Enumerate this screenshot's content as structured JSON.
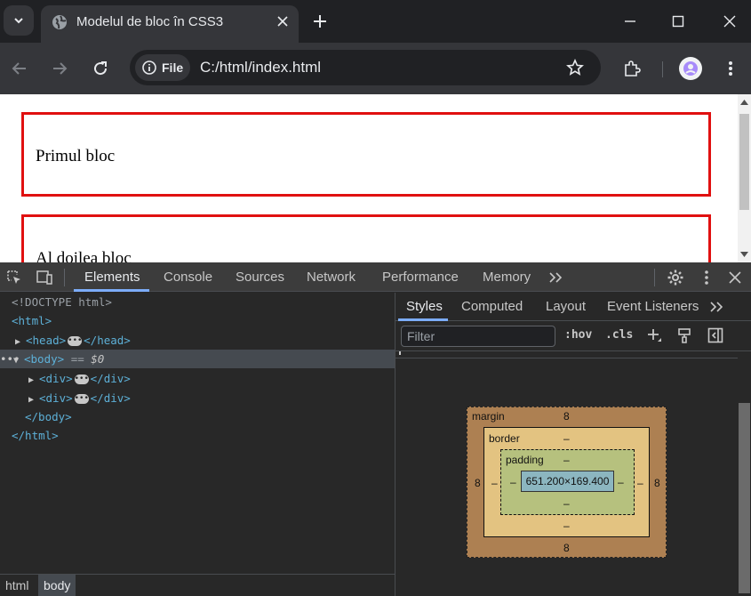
{
  "browser": {
    "tab": {
      "title": "Modelul de bloc în CSS3",
      "favicon": "globe-icon"
    },
    "chip_label": "File",
    "url": "C:/html/index.html"
  },
  "page": {
    "blocks": [
      {
        "text": "Primul bloc"
      },
      {
        "text": "Al doilea bloc"
      }
    ],
    "border_color": "#e01010"
  },
  "devtools": {
    "tabs": [
      "Elements",
      "Console",
      "Sources",
      "Network",
      "Performance",
      "Memory"
    ],
    "active_tab": "Elements",
    "dom": {
      "doctype": "<!DOCTYPE html>",
      "html_open": "<html>",
      "head_open": "<head>",
      "head_close": "</head>",
      "body_open": "<body>",
      "body_eq": "==",
      "body_ref": "$0",
      "div_open": "<div>",
      "div_close": "</div>",
      "body_close": "</body>",
      "html_close": "</html>"
    },
    "breadcrumbs": [
      "html",
      "body"
    ],
    "styles_tabs": [
      "Styles",
      "Computed",
      "Layout",
      "Event Listeners"
    ],
    "filter_placeholder": "Filter",
    "hov_label": ":hov",
    "cls_label": ".cls",
    "box_model": {
      "margin_label": "margin",
      "border_label": "border",
      "padding_label": "padding",
      "margin_top": "8",
      "margin_bottom": "8",
      "margin_left": "8",
      "margin_right": "8",
      "border_top": "–",
      "border_bottom": "–",
      "border_left": "–",
      "border_right": "–",
      "padding_top": "–",
      "padding_bottom": "–",
      "padding_left": "–",
      "padding_right": "–",
      "content_size": "651.200×169.400"
    }
  }
}
